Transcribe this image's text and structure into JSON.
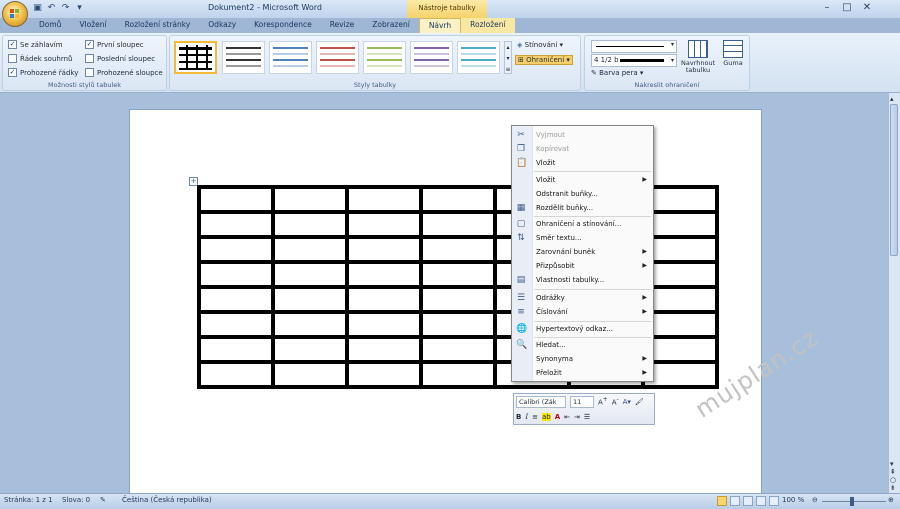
{
  "titlebar": {
    "doc_title": "Dokument2 - Microsoft Word",
    "tools_title": "Nástroje tabulky",
    "window_controls": [
      "minimize-icon",
      "maximize-icon",
      "close-icon"
    ]
  },
  "tabs": [
    {
      "label": "Domů"
    },
    {
      "label": "Vložení"
    },
    {
      "label": "Rozložení stránky"
    },
    {
      "label": "Odkazy"
    },
    {
      "label": "Korespondence"
    },
    {
      "label": "Revize"
    },
    {
      "label": "Zobrazení"
    },
    {
      "label": "Návrh"
    },
    {
      "label": "Rozložení"
    }
  ],
  "ribbon": {
    "options_group": {
      "label": "Možnosti stylů tabulek",
      "checks": [
        {
          "label": "Se záhlavím",
          "checked": true
        },
        {
          "label": "Řádek souhrnů",
          "checked": false
        },
        {
          "label": "Prohozené řádky",
          "checked": true
        },
        {
          "label": "První sloupec",
          "checked": true
        },
        {
          "label": "Poslední sloupec",
          "checked": false
        },
        {
          "label": "Prohozené sloupce",
          "checked": false
        }
      ]
    },
    "styles_group": {
      "label": "Styly tabulky",
      "shading_label": "Stínování",
      "borders_label": "Ohraničení"
    },
    "draw_group": {
      "label": "Nakreslit ohraničení",
      "line_width": "4 1/2 b",
      "pen_color_label": "Barva pera",
      "draw_table_label": "Navrhnout tabulku",
      "eraser_label": "Guma"
    }
  },
  "context_menu": {
    "items": [
      {
        "label": "Vyjmout",
        "icon": "scissors-icon",
        "disabled": true
      },
      {
        "label": "Kopírovat",
        "icon": "copy-icon",
        "disabled": true
      },
      {
        "label": "Vložit",
        "icon": "paste-icon",
        "disabled": false
      },
      {
        "label": "Vložit",
        "icon": "",
        "disabled": false,
        "submenu": true
      },
      {
        "label": "Odstranit buňky...",
        "icon": "",
        "disabled": false
      },
      {
        "label": "Rozdělit buňky...",
        "icon": "split-cells-icon",
        "disabled": false
      },
      {
        "label": "Ohraničení a stínování...",
        "icon": "borders-icon",
        "disabled": false
      },
      {
        "label": "Směr textu...",
        "icon": "text-direction-icon",
        "disabled": false
      },
      {
        "label": "Zarovnání buněk",
        "icon": "",
        "disabled": false,
        "submenu": true
      },
      {
        "label": "Přizpůsobit",
        "icon": "",
        "disabled": false,
        "submenu": true
      },
      {
        "label": "Vlastnosti tabulky...",
        "icon": "table-properties-icon",
        "disabled": false
      },
      {
        "label": "Odrážky",
        "icon": "bullets-icon",
        "disabled": false,
        "submenu": true
      },
      {
        "label": "Číslování",
        "icon": "numbering-icon",
        "disabled": false,
        "submenu": true
      },
      {
        "label": "Hypertextový odkaz...",
        "icon": "hyperlink-icon",
        "disabled": false
      },
      {
        "label": "Hledat...",
        "icon": "search-icon",
        "disabled": false
      },
      {
        "label": "Synonyma",
        "icon": "",
        "disabled": false,
        "submenu": true
      },
      {
        "label": "Přeložit",
        "icon": "",
        "disabled": false,
        "submenu": true
      }
    ]
  },
  "minibar": {
    "font": "Calibri (Zák",
    "size": "11",
    "buttons": [
      "B",
      "I"
    ]
  },
  "watermark": "mujplan.cz",
  "statusbar": {
    "page": "Stránka: 1 z 1",
    "words": "Slova: 0",
    "language": "Čeština (Česká republika)",
    "zoom": "100 %"
  },
  "colors": {
    "ribbon_bg": "#dbe6f4",
    "context_tab": "#f9e7a4",
    "selected_style_border": "#f4b937"
  }
}
